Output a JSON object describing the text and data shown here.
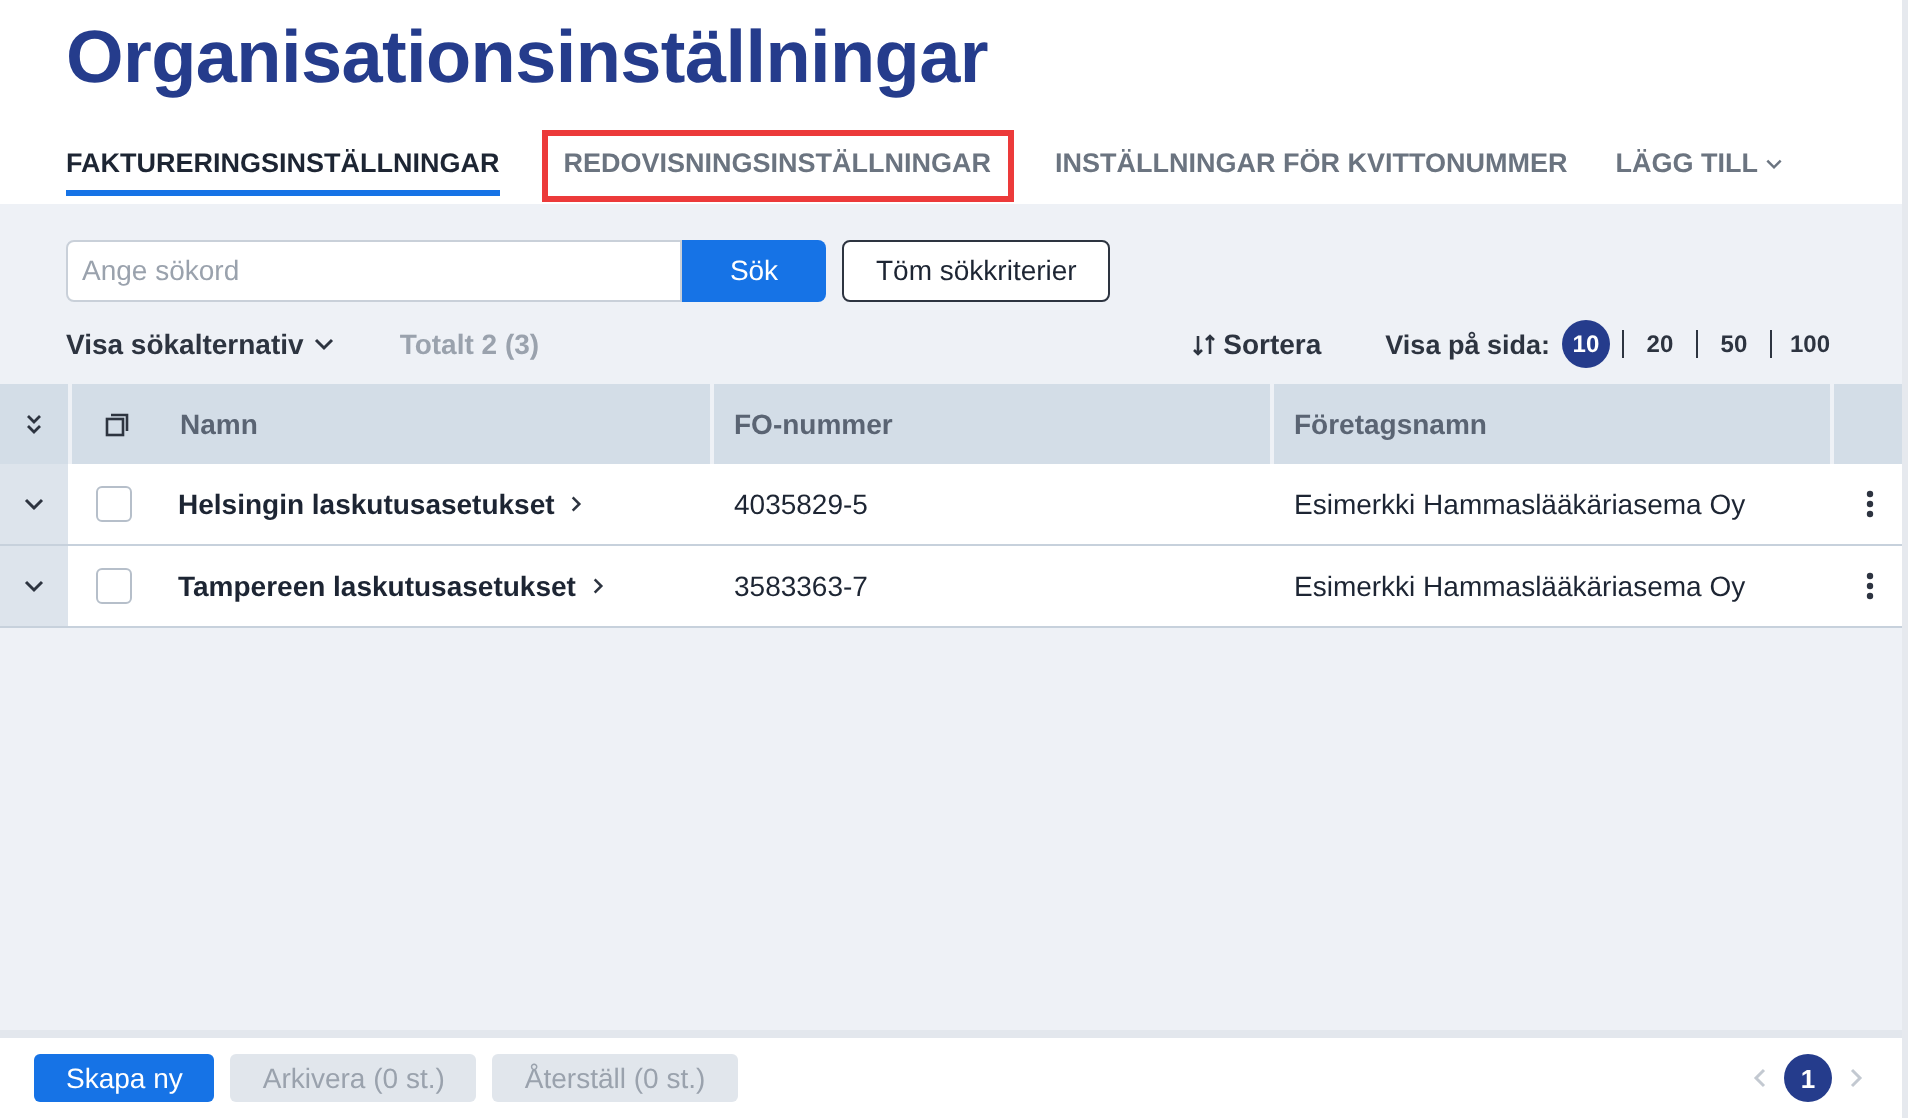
{
  "title": "Organisationsinställningar",
  "tabs": [
    {
      "label": "FAKTURERINGSINSTÄLLNINGAR",
      "selected": true,
      "highlighted": false,
      "dropdown": false
    },
    {
      "label": "REDOVISNINGSINSTÄLLNINGAR",
      "selected": false,
      "highlighted": true,
      "dropdown": false
    },
    {
      "label": "INSTÄLLNINGAR FÖR KVITTONUMMER",
      "selected": false,
      "highlighted": false,
      "dropdown": false
    },
    {
      "label": "LÄGG TILL",
      "selected": false,
      "highlighted": false,
      "dropdown": true
    }
  ],
  "search": {
    "placeholder": "Ange sökord",
    "button": "Sök",
    "clear": "Töm sökkriterier"
  },
  "options_toggle": "Visa sökalternativ",
  "total": "Totalt 2 (3)",
  "sort": "Sortera",
  "page_size": {
    "label": "Visa på sida:",
    "options": [
      {
        "label": "10",
        "selected": true
      },
      {
        "label": "20",
        "selected": false
      },
      {
        "label": "50",
        "selected": false
      },
      {
        "label": "100",
        "selected": false
      }
    ]
  },
  "table": {
    "columns": [
      "Namn",
      "FO-nummer",
      "Företagsnamn"
    ],
    "rows": [
      {
        "name": "Helsingin laskutusasetukset",
        "fo": "4035829-5",
        "company": "Esimerkki Hammaslääkäriasema Oy",
        "checked": false
      },
      {
        "name": "Tampereen laskutusasetukset",
        "fo": "3583363-7",
        "company": "Esimerkki Hammaslääkäriasema Oy",
        "checked": false
      }
    ]
  },
  "footer": {
    "buttons": [
      {
        "label": "Skapa ny",
        "disabled": false
      },
      {
        "label": "Arkivera (0 st.)",
        "disabled": true
      },
      {
        "label": "Återställ (0 st.)",
        "disabled": true
      }
    ],
    "pages": [
      {
        "label": "1",
        "selected": true
      }
    ]
  }
}
